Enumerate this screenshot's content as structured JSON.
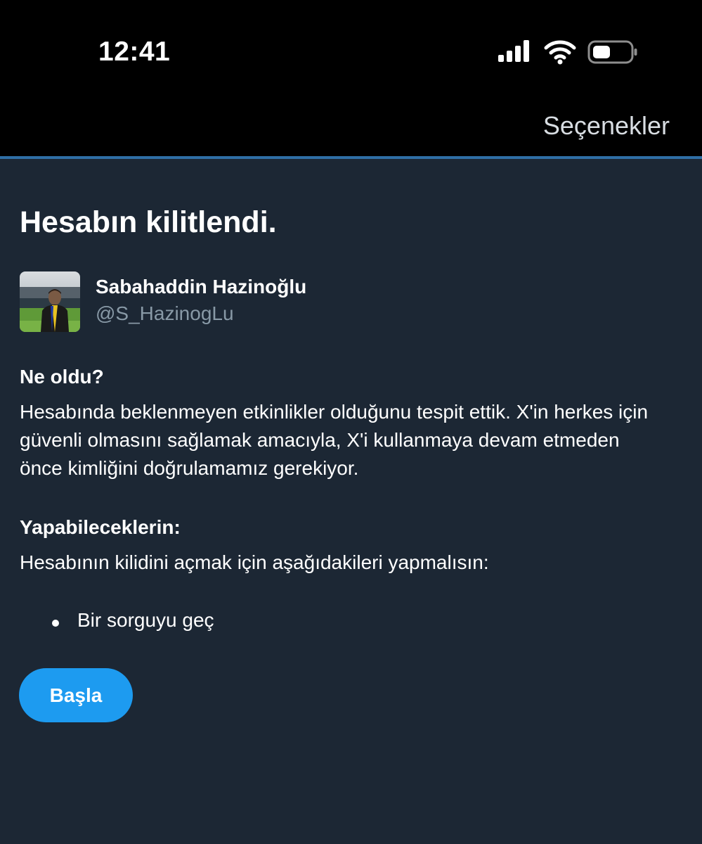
{
  "status_bar": {
    "time": "12:41",
    "icons": [
      "signal-icon",
      "wifi-icon",
      "battery-icon"
    ]
  },
  "nav": {
    "options_label": "Seçenekler"
  },
  "page": {
    "title": "Hesabın kilitlendi."
  },
  "profile": {
    "display_name": "Sabahaddin Hazinoğlu",
    "handle": "@S_HazinogLu"
  },
  "what_happened": {
    "heading": "Ne oldu?",
    "text": "Hesabında beklenmeyen etkinlikler olduğunu tespit ettik. X'in herkes için güvenli olmasını sağlamak amacıyla, X'i kullanmaya devam etmeden önce kimliğini doğrulamamız gerekiyor."
  },
  "what_you_can_do": {
    "heading": "Yapabileceklerin:",
    "text": "Hesabının kilidini açmak için aşağıdakileri yapmalısın:",
    "items": [
      "Bir sorguyu geç"
    ]
  },
  "actions": {
    "start_label": "Başla"
  },
  "colors": {
    "background": "#1c2734",
    "top_bar": "#000000",
    "accent_line": "#2f6fa6",
    "button": "#1d9bf0",
    "handle_text": "#8899a6"
  }
}
